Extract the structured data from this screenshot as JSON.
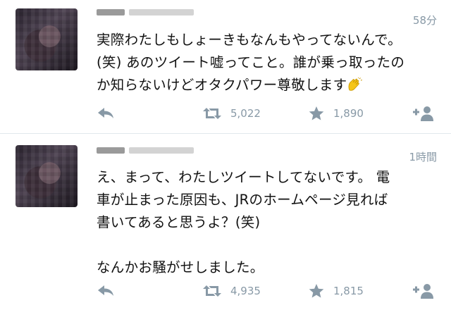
{
  "tweets": [
    {
      "time": "58分",
      "lines": [
        "実際わたしもしょーきもなんもやってないんで。",
        "(笑) あのツイート嘘ってこと。誰が乗っ取ったの",
        "か知らないけどオタクパワー尊敬します"
      ],
      "emoji": "clapping-hands",
      "retweets": "5,022",
      "favorites": "1,890"
    },
    {
      "time": "1時間",
      "lines": [
        "え、まって、わたしツイートしてないです。 電",
        "車が止まった原因も、JRのホームページ見れば",
        "書いてあると思うよ？(笑)",
        "",
        "なんかお騒がせしました。"
      ],
      "retweets": "4,935",
      "favorites": "1,815"
    }
  ],
  "colors": {
    "icon": "#8899a6",
    "count": "#8899a6",
    "divider": "#e1e8ed",
    "emoji": "#f5c518"
  }
}
